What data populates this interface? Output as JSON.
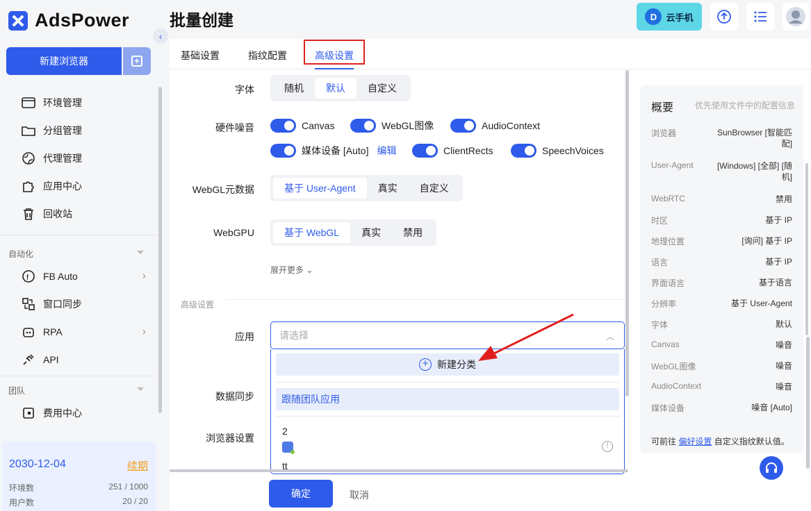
{
  "app": {
    "name": "AdsPower"
  },
  "sidebar": {
    "new_browser": "新建浏览器",
    "items": [
      {
        "label": "环境管理",
        "icon": "window-icon"
      },
      {
        "label": "分组管理",
        "icon": "folder-icon"
      },
      {
        "label": "代理管理",
        "icon": "globe-icon"
      },
      {
        "label": "应用中心",
        "icon": "puzzle-icon"
      },
      {
        "label": "回收站",
        "icon": "trash-icon"
      }
    ],
    "automation_label": "自动化",
    "automation_items": [
      {
        "label": "FB Auto",
        "icon": "facebook-icon"
      },
      {
        "label": "窗口同步",
        "icon": "sync-icon"
      },
      {
        "label": "RPA",
        "icon": "robot-icon"
      },
      {
        "label": "API",
        "icon": "plug-icon"
      }
    ],
    "team_label": "团队",
    "team_items": [
      {
        "label": "费用中心",
        "icon": "wallet-icon"
      }
    ],
    "subscription": {
      "date": "2030-12-04",
      "renew": "续期",
      "env_label": "环境数",
      "env_value": "251 / 1000",
      "user_label": "用户数",
      "user_value": "20 / 20"
    }
  },
  "header": {
    "title": "批量创建",
    "cloud_phone": "云手机"
  },
  "tabs": [
    "基础设置",
    "指纹配置",
    "高级设置"
  ],
  "form": {
    "font": {
      "label": "字体",
      "options": [
        "随机",
        "默认",
        "自定义"
      ],
      "selected": "默认"
    },
    "hardware_noise": {
      "label": "硬件噪音",
      "toggles": [
        "Canvas",
        "WebGL图像",
        "AudioContext",
        "媒体设备 [Auto]",
        "ClientRects",
        "SpeechVoices"
      ],
      "edit": "编辑"
    },
    "webgl_meta": {
      "label": "WebGL元数据",
      "options": [
        "基于 User-Agent",
        "真实",
        "自定义"
      ],
      "selected": "基于 User-Agent"
    },
    "webgpu": {
      "label": "WebGPU",
      "options": [
        "基于 WebGL",
        "真实",
        "禁用"
      ],
      "selected": "基于 WebGL"
    },
    "expand_more": "展开更多",
    "section_advanced": "高级设置",
    "app": {
      "label": "应用",
      "placeholder": "请选择",
      "new_category": "新建分类",
      "follow_team": "跟随团队应用",
      "items": [
        "2",
        "tt"
      ]
    },
    "data_sync": {
      "label": "数据同步"
    },
    "browser_settings": {
      "label": "浏览器设置"
    }
  },
  "footer": {
    "confirm": "确定",
    "cancel": "取消"
  },
  "summary": {
    "title": "概要",
    "hint": "优先使用文件中的配置信息",
    "rows": [
      {
        "k": "浏览器",
        "v": "SunBrowser [智能匹配]"
      },
      {
        "k": "User-Agent",
        "v": "[Windows] [全部] [随机]"
      },
      {
        "k": "WebRTC",
        "v": "禁用"
      },
      {
        "k": "时区",
        "v": "基于 IP"
      },
      {
        "k": "地理位置",
        "v": "[询问] 基于 IP"
      },
      {
        "k": "语言",
        "v": "基于 IP"
      },
      {
        "k": "界面语言",
        "v": "基于语言"
      },
      {
        "k": "分辨率",
        "v": "基于 User-Agent"
      },
      {
        "k": "字体",
        "v": "默认"
      },
      {
        "k": "Canvas",
        "v": "噪音"
      },
      {
        "k": "WebGL图像",
        "v": "噪音"
      },
      {
        "k": "AudioContext",
        "v": "噪音"
      },
      {
        "k": "媒体设备",
        "v": "噪音 [Auto]"
      }
    ],
    "footer_pre": "可前往",
    "footer_link": "偏好设置",
    "footer_post": "自定义指纹默认值。"
  },
  "colors": {
    "accent": "#2f5bea",
    "highlight_box": "#e02020",
    "arrow": "#e02020"
  }
}
